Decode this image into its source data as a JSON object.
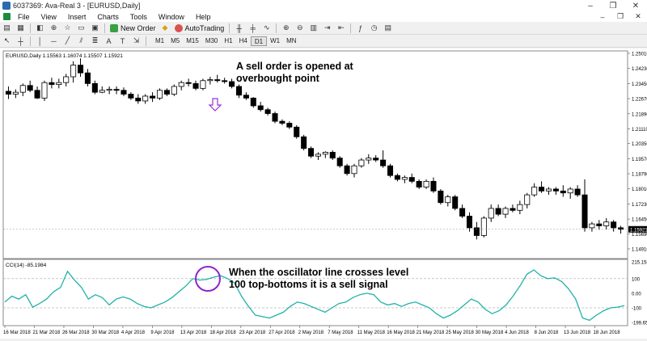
{
  "window": {
    "title": "6037369: Ava-Real 3 - [EURUSD,Daily]"
  },
  "window_controls": {
    "minimize": "–",
    "maximize": "❐",
    "close": "✕"
  },
  "menu": {
    "items": [
      "File",
      "View",
      "Insert",
      "Charts",
      "Tools",
      "Window",
      "Help"
    ]
  },
  "toolbar": {
    "new_order": "New Order",
    "autotrading": "AutoTrading"
  },
  "timeframes": [
    "M1",
    "M5",
    "M15",
    "M30",
    "H1",
    "H4",
    "D1",
    "W1",
    "MN"
  ],
  "active_timeframe": "D1",
  "chart": {
    "header": "EURUSD,Daily  1.15563 1.16074 1.15507 1.15921",
    "price_ticks": [
      "1.25010",
      "1.24230",
      "1.23450",
      "1.22670",
      "1.21890",
      "1.21110",
      "1.20350",
      "1.19570",
      "1.18790",
      "1.18010",
      "1.17230",
      "1.16450",
      "1.15921",
      "1.15690",
      "1.14910"
    ],
    "date_ticks": [
      "16 Mar 2018",
      "21 Mar 2018",
      "26 Mar 2018",
      "30 Mar 2018",
      "4 Apr 2018",
      "9 Apr 2018",
      "13 Apr 2018",
      "18 Apr 2018",
      "23 Apr 2018",
      "27 Apr 2018",
      "2 May 2018",
      "7 May 2018",
      "11 May 2018",
      "16 May 2018",
      "21 May 2018",
      "25 May 2018",
      "30 May 2018",
      "4 Jun 2018",
      "8 Jun 2018",
      "13 Jun 2018",
      "18 Jun 2018"
    ],
    "current_price": "1.15921"
  },
  "indicator": {
    "header": "CCI(14) -85.1984",
    "ticks": [
      "215.158",
      "100",
      "0.00",
      "-100",
      "-199.653"
    ],
    "line_color": "#20b2aa",
    "values": [
      -60,
      -20,
      -40,
      -10,
      -95,
      -70,
      -40,
      10,
      40,
      150,
      90,
      40,
      -40,
      -10,
      -30,
      -80,
      -40,
      -25,
      -40,
      -70,
      -90,
      -100,
      -80,
      -60,
      -30,
      10,
      50,
      100,
      90,
      95,
      110,
      120,
      100,
      70,
      -20,
      -90,
      -150,
      -160,
      -170,
      -150,
      -130,
      -90,
      -60,
      -70,
      -90,
      -110,
      -130,
      -100,
      -70,
      -60,
      -30,
      -10,
      0,
      -10,
      -60,
      -80,
      -70,
      -90,
      -70,
      -60,
      -80,
      -100,
      -140,
      -170,
      -150,
      -120,
      -80,
      -40,
      -60,
      -110,
      -140,
      -120,
      -80,
      -20,
      50,
      130,
      160,
      120,
      100,
      105,
      80,
      30,
      -40,
      -170,
      -185,
      -150,
      -120,
      -100,
      -95,
      -85
    ]
  },
  "candles": [
    [
      1.2305,
      1.233,
      1.2265,
      1.229
    ],
    [
      1.229,
      1.2315,
      1.227,
      1.23
    ],
    [
      1.23,
      1.2345,
      1.228,
      1.2335
    ],
    [
      1.2335,
      1.236,
      1.23,
      1.231
    ],
    [
      1.231,
      1.233,
      1.2265,
      1.227
    ],
    [
      1.227,
      1.236,
      1.2255,
      1.235
    ],
    [
      1.235,
      1.2375,
      1.232,
      1.234
    ],
    [
      1.234,
      1.237,
      1.232,
      1.235
    ],
    [
      1.235,
      1.2395,
      1.233,
      1.238
    ],
    [
      1.238,
      1.246,
      1.235,
      1.244
    ],
    [
      1.244,
      1.2475,
      1.238,
      1.24
    ],
    [
      1.24,
      1.242,
      1.233,
      1.2345
    ],
    [
      1.2345,
      1.236,
      1.229,
      1.23
    ],
    [
      1.23,
      1.233,
      1.2295,
      1.231
    ],
    [
      1.231,
      1.233,
      1.229,
      1.2315
    ],
    [
      1.2315,
      1.233,
      1.229,
      1.231
    ],
    [
      1.231,
      1.2325,
      1.228,
      1.229
    ],
    [
      1.229,
      1.23,
      1.226,
      1.227
    ],
    [
      1.227,
      1.229,
      1.224,
      1.2255
    ],
    [
      1.2255,
      1.229,
      1.224,
      1.228
    ],
    [
      1.228,
      1.23,
      1.225,
      1.227
    ],
    [
      1.227,
      1.232,
      1.226,
      1.231
    ],
    [
      1.231,
      1.232,
      1.228,
      1.229
    ],
    [
      1.229,
      1.234,
      1.228,
      1.233
    ],
    [
      1.233,
      1.236,
      1.231,
      1.235
    ],
    [
      1.235,
      1.237,
      1.233,
      1.2345
    ],
    [
      1.2345,
      1.236,
      1.231,
      1.232
    ],
    [
      1.232,
      1.237,
      1.231,
      1.236
    ],
    [
      1.236,
      1.238,
      1.234,
      1.2365
    ],
    [
      1.2365,
      1.239,
      1.235,
      1.236
    ],
    [
      1.236,
      1.2375,
      1.2345,
      1.2355
    ],
    [
      1.2355,
      1.237,
      1.232,
      1.233
    ],
    [
      1.233,
      1.234,
      1.227,
      1.2285
    ],
    [
      1.2285,
      1.23,
      1.226,
      1.227
    ],
    [
      1.227,
      1.2275,
      1.222,
      1.223
    ],
    [
      1.223,
      1.225,
      1.22,
      1.221
    ],
    [
      1.221,
      1.222,
      1.218,
      1.219
    ],
    [
      1.219,
      1.22,
      1.214,
      1.215
    ],
    [
      1.215,
      1.216,
      1.213,
      1.214
    ],
    [
      1.214,
      1.215,
      1.211,
      1.212
    ],
    [
      1.212,
      1.213,
      1.206,
      1.207
    ],
    [
      1.207,
      1.208,
      1.2,
      1.201
    ],
    [
      1.201,
      1.202,
      1.196,
      1.197
    ],
    [
      1.197,
      1.199,
      1.195,
      1.198
    ],
    [
      1.198,
      1.1995,
      1.196,
      1.199
    ],
    [
      1.199,
      1.2,
      1.195,
      1.196
    ],
    [
      1.196,
      1.197,
      1.191,
      1.192
    ],
    [
      1.192,
      1.193,
      1.187,
      1.188
    ],
    [
      1.188,
      1.193,
      1.186,
      1.192
    ],
    [
      1.192,
      1.196,
      1.191,
      1.195
    ],
    [
      1.195,
      1.198,
      1.193,
      1.196
    ],
    [
      1.196,
      1.1975,
      1.194,
      1.195
    ],
    [
      1.195,
      1.2,
      1.191,
      1.192
    ],
    [
      1.192,
      1.193,
      1.186,
      1.187
    ],
    [
      1.187,
      1.188,
      1.184,
      1.185
    ],
    [
      1.185,
      1.187,
      1.183,
      1.186
    ],
    [
      1.186,
      1.188,
      1.183,
      1.184
    ],
    [
      1.184,
      1.185,
      1.18,
      1.181
    ],
    [
      1.181,
      1.185,
      1.18,
      1.184
    ],
    [
      1.184,
      1.186,
      1.178,
      1.179
    ],
    [
      1.179,
      1.18,
      1.172,
      1.173
    ],
    [
      1.173,
      1.177,
      1.171,
      1.176
    ],
    [
      1.176,
      1.177,
      1.169,
      1.17
    ],
    [
      1.17,
      1.172,
      1.165,
      1.166
    ],
    [
      1.166,
      1.168,
      1.158,
      1.16
    ],
    [
      1.16,
      1.163,
      1.154,
      1.156
    ],
    [
      1.156,
      1.166,
      1.155,
      1.165
    ],
    [
      1.165,
      1.172,
      1.163,
      1.17
    ],
    [
      1.17,
      1.172,
      1.166,
      1.167
    ],
    [
      1.167,
      1.171,
      1.165,
      1.17
    ],
    [
      1.17,
      1.172,
      1.168,
      1.169
    ],
    [
      1.169,
      1.174,
      1.167,
      1.172
    ],
    [
      1.172,
      1.178,
      1.17,
      1.177
    ],
    [
      1.177,
      1.183,
      1.176,
      1.181
    ],
    [
      1.181,
      1.184,
      1.178,
      1.179
    ],
    [
      1.179,
      1.181,
      1.177,
      1.18
    ],
    [
      1.18,
      1.181,
      1.177,
      1.179
    ],
    [
      1.179,
      1.182,
      1.176,
      1.178
    ],
    [
      1.178,
      1.181,
      1.175,
      1.18
    ],
    [
      1.18,
      1.182,
      1.176,
      1.177
    ],
    [
      1.177,
      1.185,
      1.158,
      1.16
    ],
    [
      1.16,
      1.163,
      1.158,
      1.162
    ],
    [
      1.162,
      1.164,
      1.159,
      1.161
    ],
    [
      1.161,
      1.165,
      1.159,
      1.163
    ],
    [
      1.163,
      1.164,
      1.158,
      1.16
    ],
    [
      1.16,
      1.161,
      1.157,
      1.1592
    ]
  ],
  "annotations": {
    "sell_order_line1": "A sell order is opened at",
    "sell_order_line2": "overbought point",
    "oscillator_line1": "When the oscillator line crosses level",
    "oscillator_line2": "100 top-bottoms it is a sell signal",
    "arrow_color": "#9b30d9",
    "circle_color": "#8e24c9"
  }
}
